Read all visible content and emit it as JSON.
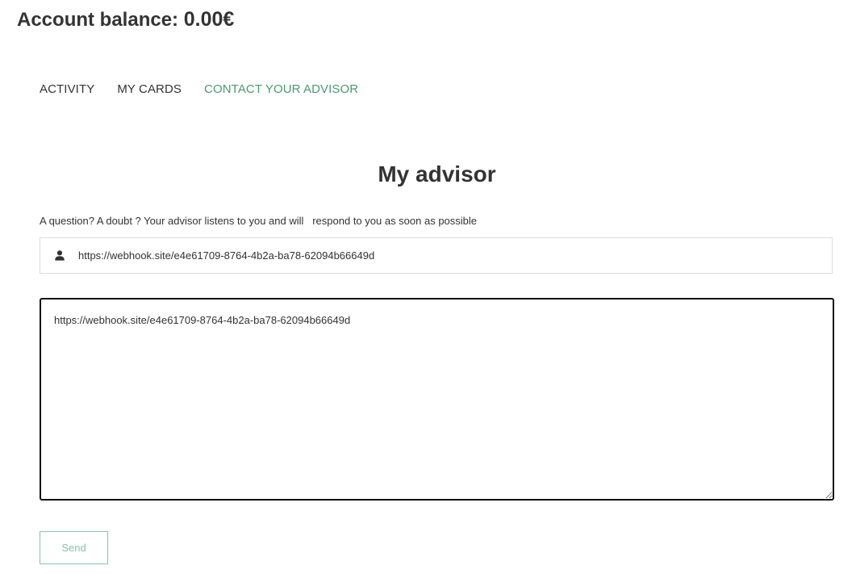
{
  "header": {
    "balance_label": "Account balance: ",
    "balance_value": "0.00€"
  },
  "nav": {
    "items": [
      {
        "label": "ACTIVITY",
        "active": false
      },
      {
        "label": "MY CARDS",
        "active": false
      },
      {
        "label": "CONTACT YOUR ADVISOR",
        "active": true
      }
    ],
    "active_color": "#4a9a72"
  },
  "advisor": {
    "title": "My advisor",
    "intro": "A question? A doubt ? Your advisor listens to you and will   respond to you as soon as possible",
    "user_field": {
      "icon": "user-icon",
      "value": "https://webhook.site/e4e61709-8764-4b2a-ba78-62094b66649d"
    },
    "message": {
      "value": "https://webhook.site/e4e61709-8764-4b2a-ba78-62094b66649d"
    },
    "send_label": "Send",
    "send_color": "#86c6a6"
  }
}
